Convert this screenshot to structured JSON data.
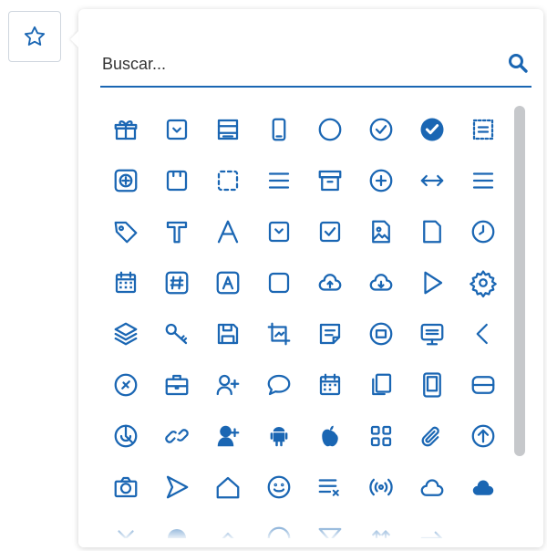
{
  "colors": {
    "accent": "#1a66b3",
    "border": "#cfd6de",
    "scrollbar": "#c6c8cb"
  },
  "trigger": {
    "icon": "star-outline-icon"
  },
  "search": {
    "placeholder": "Buscar...",
    "value": "",
    "icon": "search-icon"
  },
  "icons": [
    [
      "gift-icon",
      "calendar-check-icon",
      "window-layout-icon",
      "phone-icon",
      "circle-icon",
      "circle-check-icon",
      "circle-check-solid-icon",
      "list-box-dashed-icon"
    ],
    [
      "plus-square-icon",
      "calendar-blank-icon",
      "dashed-square-icon",
      "equals-icon",
      "archive-icon",
      "circle-plus-icon",
      "arrows-horizontal-icon",
      "menu-icon"
    ],
    [
      "tag-icon",
      "text-t-icon",
      "text-a-icon",
      "select-dropdown-icon",
      "checkbox-icon",
      "image-file-icon",
      "file-icon",
      "clock-icon"
    ],
    [
      "calendar-grid-icon",
      "hash-box-icon",
      "text-box-a-icon",
      "square-icon",
      "cloud-upload-icon",
      "cloud-download-icon",
      "play-outline-icon",
      "gear-icon"
    ],
    [
      "layers-icon",
      "key-icon",
      "floppy-disk-icon",
      "crop-icon",
      "note-icon",
      "circle-note-icon",
      "monitor-icon",
      "chevron-left-icon"
    ],
    [
      "circle-slash-icon",
      "briefcase-icon",
      "user-plus-icon",
      "speech-bubble-icon",
      "calendar-icon",
      "copy-icon",
      "tablet-icon",
      "database-icon"
    ],
    [
      "pie-chart-icon",
      "link-icon",
      "support-agent-icon",
      "android-icon",
      "apple-icon",
      "grid-apps-icon",
      "paperclip-icon",
      "circle-arrow-up-icon"
    ],
    [
      "camera-icon",
      "send-icon",
      "home-icon",
      "smile-icon",
      "checklist-icon",
      "broadcast-icon",
      "cloud-outline-icon",
      "cloud-solid-icon"
    ],
    [
      "close-icon",
      "circle-dot-icon",
      "chevron-up-icon",
      "circle-partial-icon",
      "funnel-icon",
      "arrows-up-icon",
      "arrow-right-icon",
      "blank-icon"
    ]
  ]
}
